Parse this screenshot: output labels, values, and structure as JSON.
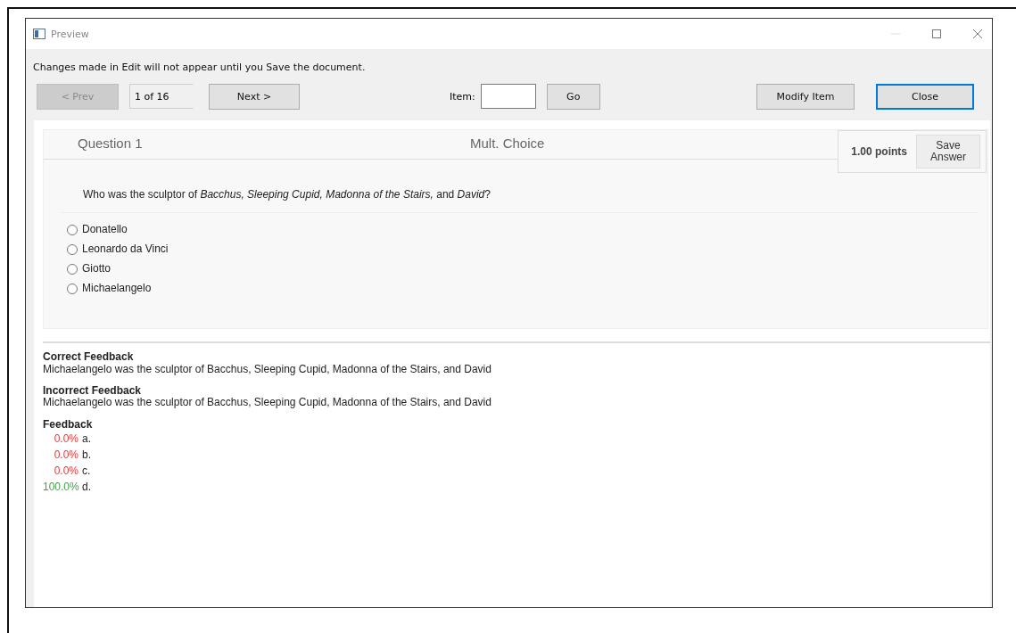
{
  "window": {
    "title": "Preview"
  },
  "notice": "Changes made in Edit will not appear until you Save the document.",
  "toolbar": {
    "prev": {
      "label": "< Prev",
      "disabled": true
    },
    "position": "1 of 16",
    "next": {
      "label": "Next >",
      "disabled": false
    },
    "item_label": "Item:",
    "go": "Go",
    "modify": "Modify Item",
    "close": "Close"
  },
  "question": {
    "number": "Question 1",
    "type": "Mult. Choice",
    "points": "1.00 points",
    "save": "Save Answer",
    "text": "Who was the sculptor of *Bacchus, Sleeping Cupid, Madonna of the Stairs,* and *David*?",
    "options": [
      {
        "label": "Donatello",
        "selected": false
      },
      {
        "label": "Leonardo da Vinci",
        "selected": false
      },
      {
        "label": "Giotto",
        "selected": false
      },
      {
        "label": "Michaelangelo",
        "selected": false
      }
    ]
  },
  "feedback": [
    {
      "heading": "Correct Feedback",
      "text": "Michaelangelo was the sculptor of Bacchus, Sleeping Cupid, Madonna of the Stairs, and David"
    },
    {
      "heading": "Incorrect Feedback",
      "text": "Michaelangelo was the sculptor of Bacchus, Sleeping Cupid, Madonna of the Stairs, and David"
    }
  ],
  "stats": {
    "heading": "Feedback",
    "items": [
      {
        "percent": "0.0%",
        "letter": "a.",
        "color": "#e53935"
      },
      {
        "percent": "0.0%",
        "letter": "b.",
        "color": "#e53935"
      },
      {
        "percent": "0.0%",
        "letter": "c.",
        "color": "#e53935"
      },
      {
        "percent": "100.0%",
        "letter": "d.",
        "color": "#43a047"
      }
    ]
  }
}
